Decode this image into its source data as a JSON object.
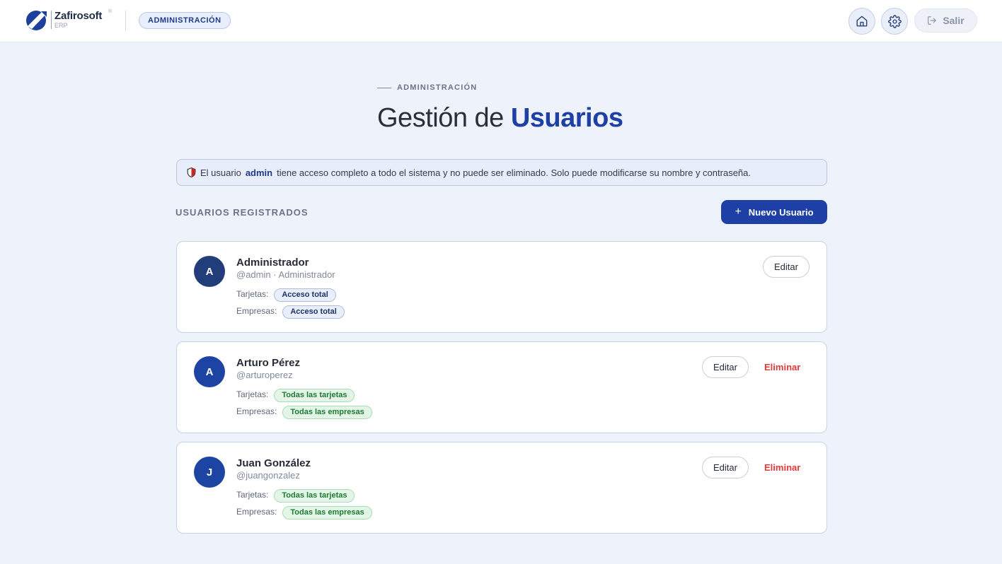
{
  "header": {
    "brand_name": "Zafirosoft",
    "brand_sub": "ERP",
    "brand_reg": "®",
    "section_pill": "ADMINISTRACIÓN",
    "exit_label": "Salir",
    "icons": [
      "home-icon",
      "gear-icon",
      "logout-icon"
    ]
  },
  "page": {
    "eyebrow": "ADMINISTRACIÓN",
    "title_prefix": "Gestión de ",
    "title_highlight": "Usuarios"
  },
  "notice": {
    "prefix": "El usuario",
    "user": "admin",
    "suffix": "tiene acceso completo a todo el sistema y no puede ser eliminado. Solo puede modificarse su nombre y contraseña."
  },
  "users_section": {
    "label": "USUARIOS REGISTRADOS",
    "new_button": "Nuevo Usuario",
    "users": [
      {
        "initial": "A",
        "name": "Administrador",
        "handle": "@admin · Administrador",
        "tarjetas_label": "Tarjetas:",
        "tarjetas_value": "Acceso total",
        "empresas_label": "Empresas:",
        "empresas_value": "Acceso total",
        "edit_label": "Editar"
      },
      {
        "initial": "A",
        "name": "Arturo Pérez",
        "handle": "@arturoperez",
        "tarjetas_label": "Tarjetas:",
        "tarjetas_value": "Todas las tarjetas",
        "empresas_label": "Empresas:",
        "empresas_value": "Todas las empresas",
        "edit_label": "Editar",
        "delete_label": "Eliminar"
      },
      {
        "initial": "J",
        "name": "Juan González",
        "handle": "@juangonzalez",
        "tarjetas_label": "Tarjetas:",
        "tarjetas_value": "Todas las tarjetas",
        "empresas_label": "Empresas:",
        "empresas_value": "Todas las empresas",
        "edit_label": "Editar",
        "delete_label": "Eliminar"
      }
    ]
  },
  "colors": {
    "accent": "#1e40a6",
    "danger": "#e03a3a",
    "success": "#1f7a35",
    "background": "#eef2fa"
  }
}
